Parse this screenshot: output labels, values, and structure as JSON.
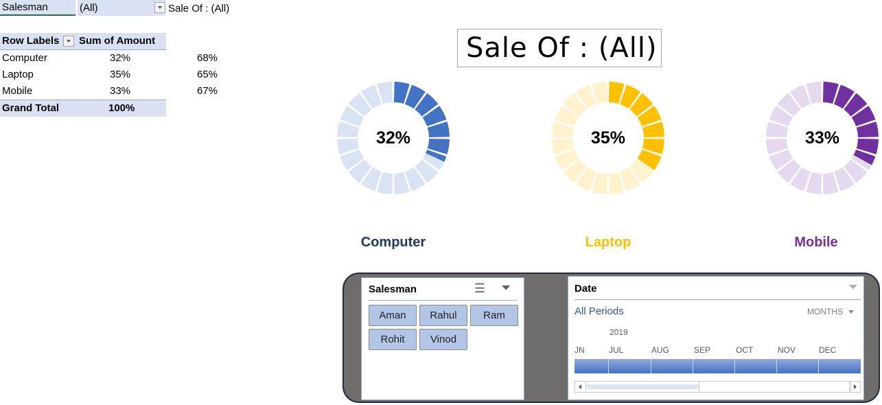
{
  "filter": {
    "field": "Salesman",
    "value": "(All)",
    "caption": "Sale Of : (All)"
  },
  "pivot": {
    "headers": [
      "Row Labels",
      "Sum of Amount"
    ],
    "rows": [
      {
        "label": "Computer",
        "value": "32%",
        "remainder": "68%"
      },
      {
        "label": "Laptop",
        "value": "35%",
        "remainder": "65%"
      },
      {
        "label": "Mobile",
        "value": "33%",
        "remainder": "67%"
      }
    ],
    "grand_total": {
      "label": "Grand Total",
      "value": "100%"
    }
  },
  "title_box": {
    "text": "Sale Of : (All)"
  },
  "donuts": [
    {
      "label": "Computer",
      "pct_text": "32%",
      "value": 0.32,
      "color": "#4472c4",
      "light": "#dae3f3",
      "label_color": "#1f3864"
    },
    {
      "label": "Laptop",
      "pct_text": "35%",
      "value": 0.35,
      "color": "#ffc000",
      "light": "#fff2cc",
      "label_color": "#ffc000"
    },
    {
      "label": "Mobile",
      "pct_text": "33%",
      "value": 0.33,
      "color": "#7030a0",
      "light": "#e4d9ee",
      "label_color": "#7030a0"
    }
  ],
  "slicer_salesman": {
    "title": "Salesman",
    "icons": [
      "multi-select-icon",
      "clear-filter-icon"
    ],
    "items": [
      "Aman",
      "Rahul",
      "Ram",
      "Rohit",
      "Vinod"
    ]
  },
  "slicer_date": {
    "title": "Date",
    "icon": "clear-filter-icon",
    "period_label": "All Periods",
    "level": "MONTHS",
    "year": "2019",
    "months": [
      "JN",
      "JUL",
      "AUG",
      "SEP",
      "OCT",
      "NOV",
      "DEC"
    ]
  },
  "colors": {
    "header_fill": "#d9e1f2",
    "panel_bg": "#706c6c",
    "slicer_button": "#b4c6e7"
  }
}
